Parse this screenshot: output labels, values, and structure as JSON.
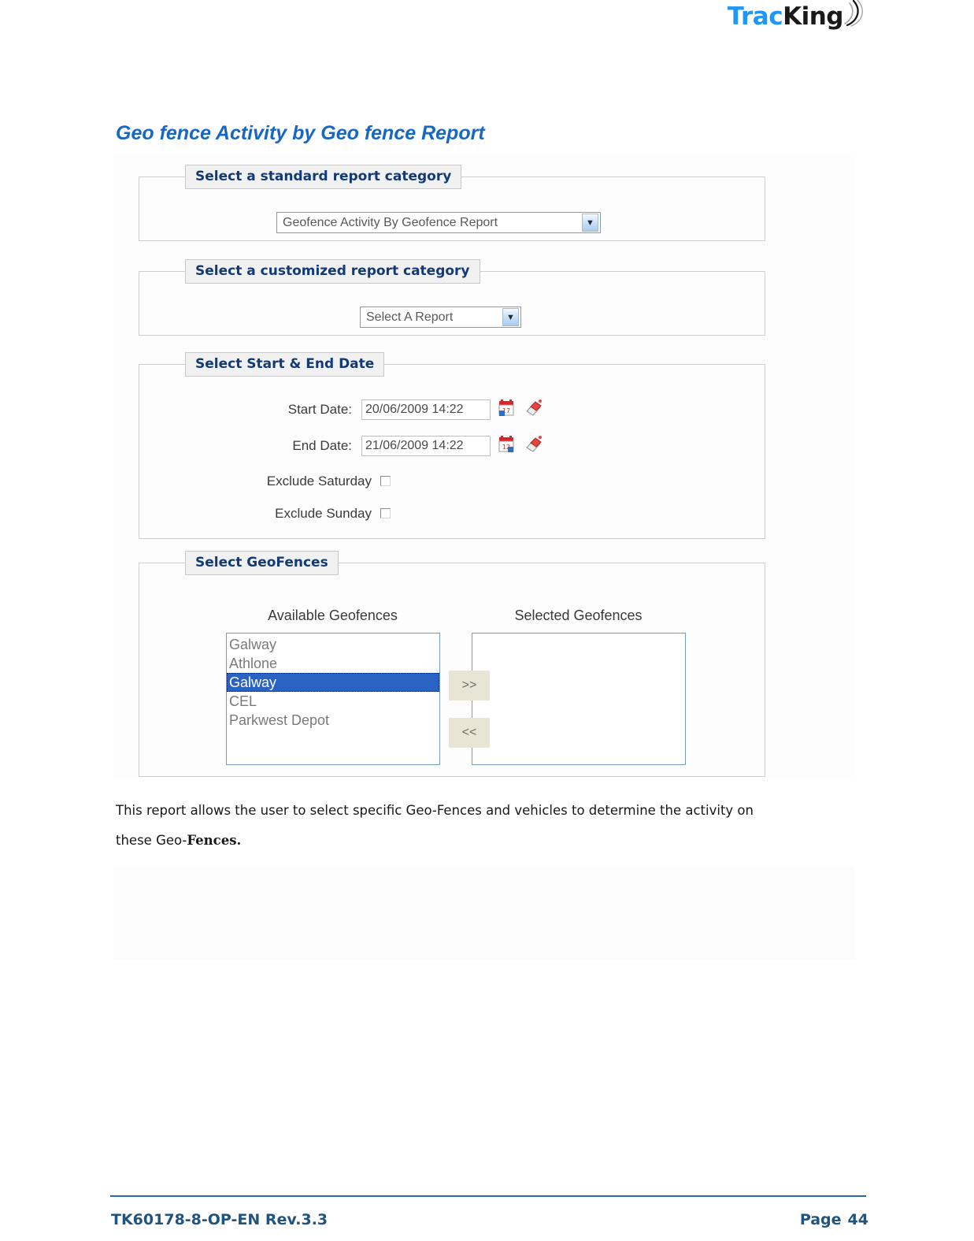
{
  "header": {
    "logo": {
      "part1": "Trac",
      "part2": "K",
      "part3": "ing",
      "waves_icon": "signal-waves-icon"
    }
  },
  "doc": {
    "title": "Geo fence Activity by Geo fence Report",
    "paragraph_line1": "This report allows the user to select specific Geo-Fences and vehicles to determine the activity on",
    "paragraph_line2_prefix": "these Geo-",
    "paragraph_line2_serif": "Fences."
  },
  "screenshot": {
    "standard_report": {
      "legend": "Select a standard report category",
      "dropdown_value": "Geofence Activity By Geofence Report",
      "dropdown_arrow": "chevron-down-icon"
    },
    "customized_report": {
      "legend": "Select a customized report category",
      "dropdown_value": "Select A Report",
      "dropdown_arrow": "chevron-down-icon"
    },
    "date_range": {
      "legend": "Select Start & End Date",
      "start_label": "Start Date:",
      "start_value": "20/06/2009 14:22",
      "end_label": "End Date:",
      "end_value": "21/06/2009 14:22",
      "calendar_icon": "calendar-icon",
      "clear_icon": "eraser-icon",
      "exclude_saturday_label": "Exclude Saturday",
      "exclude_saturday_checked": false,
      "exclude_sunday_label": "Exclude Sunday",
      "exclude_sunday_checked": false
    },
    "geofences": {
      "legend": "Select GeoFences",
      "available_caption": "Available Geofences",
      "selected_caption": "Selected Geofences",
      "available_items": [
        {
          "label": "Galway",
          "selected": false
        },
        {
          "label": "Athlone",
          "selected": false
        },
        {
          "label": "Galway",
          "selected": true
        },
        {
          "label": "CEL",
          "selected": false
        },
        {
          "label": "Parkwest Depot",
          "selected": false
        }
      ],
      "selected_items": [],
      "add_button": ">>",
      "remove_button": "<<"
    }
  },
  "footer": {
    "document_code": "TK60178-8-OP-EN Rev.3.3",
    "page_label": "Page",
    "page_number": "44"
  },
  "colors": {
    "title_blue": "#1668c4",
    "legend_blue": "#113a77",
    "footer_blue": "#1f5480",
    "selection_blue": "#2a63c4",
    "button_beige": "#e9e5d4"
  }
}
